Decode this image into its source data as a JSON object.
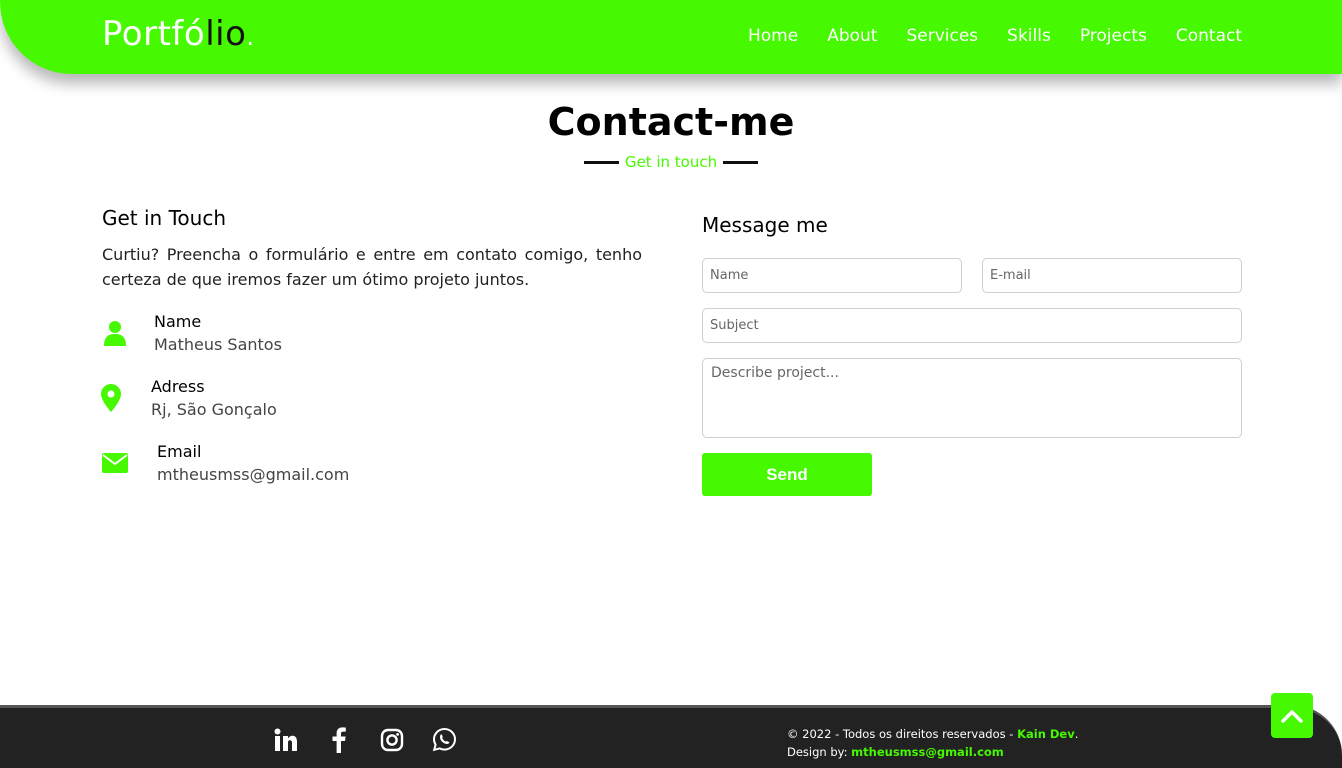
{
  "header": {
    "logo_part1": "Portfó",
    "logo_part2": "lio",
    "logo_dot": ".",
    "nav": [
      "Home",
      "About",
      "Services",
      "Skills",
      "Projects",
      "Contact"
    ]
  },
  "section": {
    "title": "Contact-me",
    "subtitle": "Get in touch"
  },
  "info": {
    "heading": "Get in Touch",
    "text": "Curtiu? Preencha o formulário e entre em contato comigo, tenho certeza de que iremos fazer um ótimo projeto juntos.",
    "items": [
      {
        "icon": "user-icon",
        "label": "Name",
        "value": "Matheus Santos"
      },
      {
        "icon": "map-pin-icon",
        "label": "Adress",
        "value": "Rj, São Gonçalo"
      },
      {
        "icon": "envelope-icon",
        "label": "Email",
        "value": "mtheusmss@gmail.com"
      }
    ]
  },
  "form": {
    "heading": "Message me",
    "name_placeholder": "Name",
    "email_placeholder": "E-mail",
    "subject_placeholder": "Subject",
    "message_placeholder": "Describe project...",
    "send_label": "Send"
  },
  "footer": {
    "socials": [
      "linkedin-icon",
      "facebook-icon",
      "instagram-icon",
      "whatsapp-icon"
    ],
    "copyright": "© 2022 - Todos os direitos reservados -",
    "brand": "Kain Dev",
    "period": ".",
    "design_label": "Design by:",
    "design_email": "mtheusmss@gmail.com"
  },
  "colors": {
    "accent": "#46f900",
    "footer_bg": "#222222"
  }
}
